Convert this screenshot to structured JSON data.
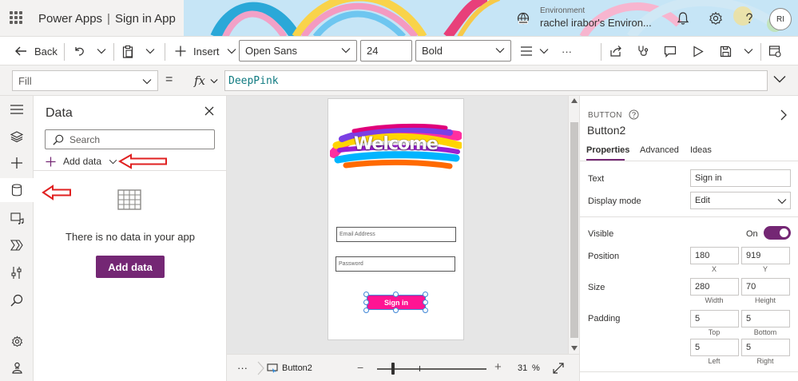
{
  "header": {
    "app_name": "Power Apps",
    "separator": "|",
    "app_title": "Sign in App",
    "environment_label": "Environment",
    "environment_name": "rachel irabor's Environ...",
    "avatar_initials": "RI",
    "icons": [
      "waffle-icon",
      "environment-icon",
      "bell-icon",
      "settings-icon",
      "help-icon"
    ]
  },
  "command_bar": {
    "back_label": "Back",
    "insert_label": "Insert",
    "font_family": "Open Sans",
    "font_size": "24",
    "font_weight": "Bold",
    "more_label": "···"
  },
  "formula_bar": {
    "property": "Fill",
    "equals": "=",
    "fx_label": "fx",
    "formula": "DeepPink"
  },
  "data_pane": {
    "title": "Data",
    "search_placeholder": "Search",
    "add_data_link": "Add data",
    "empty_message": "There is no data in your app",
    "add_data_button": "Add data"
  },
  "canvas": {
    "welcome_text": "Welcome",
    "email_placeholder": "Email Address",
    "password_placeholder": "Password",
    "button_text": "Sign in",
    "button_color": "#FF1493"
  },
  "canvas_footer": {
    "more_label": "···",
    "selected_control": "Button2",
    "zoom_minus": "−",
    "zoom_plus": "+",
    "zoom_value": "31",
    "zoom_unit": "%"
  },
  "properties": {
    "control_type": "BUTTON",
    "control_name": "Button2",
    "tabs": [
      "Properties",
      "Advanced",
      "Ideas"
    ],
    "text_label": "Text",
    "text_value": "Sign in",
    "display_mode_label": "Display mode",
    "display_mode_value": "Edit",
    "visible_label": "Visible",
    "visible_state": "On",
    "position_label": "Position",
    "position_x": "180",
    "position_y": "919",
    "x_label": "X",
    "y_label": "Y",
    "size_label": "Size",
    "size_width": "280",
    "size_height": "70",
    "width_label": "Width",
    "height_label": "Height",
    "padding_label": "Padding",
    "padding_top": "5",
    "padding_bottom": "5",
    "padding_left": "5",
    "padding_right": "5",
    "top_label": "Top",
    "bottom_label": "Bottom",
    "left_label": "Left",
    "right_label": "Right"
  },
  "colors": {
    "accent": "#742774",
    "deep_pink": "#FF1493",
    "annotation_arrow": "#E02020",
    "selection": "#3F86D6"
  }
}
